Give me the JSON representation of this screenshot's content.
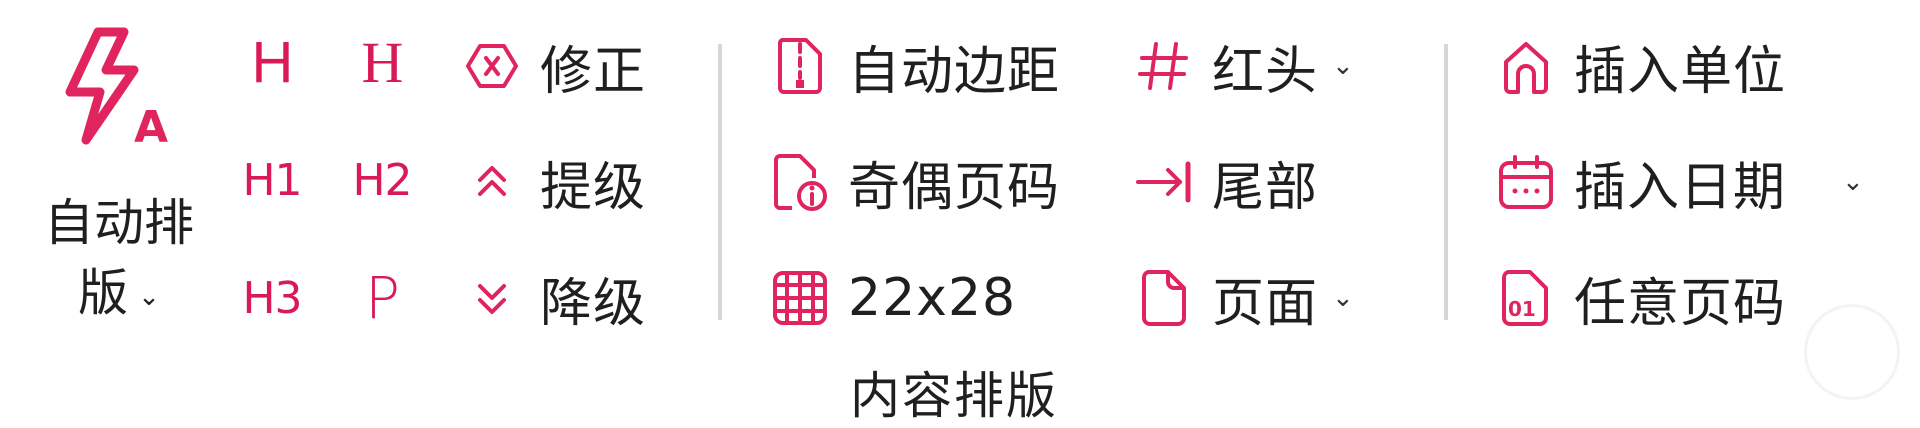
{
  "auto_layout": {
    "label_line1": "自动排",
    "label_line2": "版",
    "caret": "⌄",
    "icon": "bolt-a-icon"
  },
  "headings": {
    "h_outline": "H",
    "h_serif": "H",
    "h1": "H1",
    "h2": "H2",
    "h3": "H3",
    "p": "P"
  },
  "ops": {
    "fix": {
      "label": "修正",
      "icon": "close-hex-icon"
    },
    "promote": {
      "label": "提级",
      "icon": "double-chevron-up-icon"
    },
    "demote": {
      "label": "降级",
      "icon": "double-chevron-down-icon"
    }
  },
  "content_layout": {
    "auto_margin": {
      "label": "自动边距",
      "icon": "document-margin-icon"
    },
    "odd_even_page": {
      "label": "奇偶页码",
      "icon": "document-info-icon"
    },
    "grid": {
      "label": "22x28",
      "icon": "grid-icon"
    },
    "red_header": {
      "label": "红头",
      "icon": "hash-icon",
      "caret": "⌄"
    },
    "tail": {
      "label": "尾部",
      "icon": "arrow-to-bar-icon"
    },
    "page": {
      "label": "页面",
      "icon": "page-icon",
      "caret": "⌄"
    },
    "group_label": "内容排版"
  },
  "insert": {
    "unit": {
      "label": "插入单位",
      "icon": "home-icon"
    },
    "date": {
      "label": "插入日期",
      "icon": "calendar-icon",
      "caret": "⌄"
    },
    "any_page": {
      "label": "任意页码",
      "icon": "page-number-icon"
    }
  },
  "colors": {
    "accent": "#d81b56",
    "separator": "#d6d6d6"
  }
}
